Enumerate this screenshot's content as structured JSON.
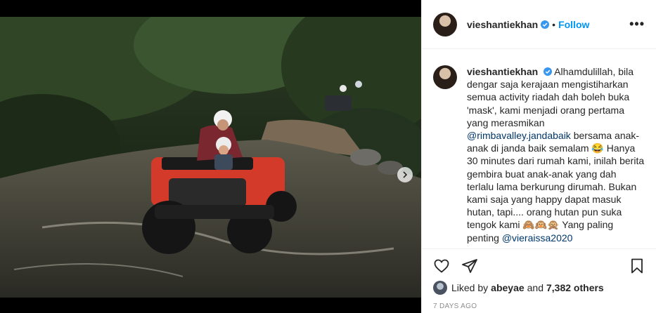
{
  "post": {
    "username": "vieshantiekhan",
    "follow_label": "Follow",
    "bullet": "•",
    "more_label": "•••"
  },
  "caption": {
    "username": "vieshantiekhan",
    "text_1": "Alhamdulillah, bila dengar saja kerajaan mengistiharkan semua activity riadah dah boleh buka 'mask', kami menjadi orang pertama yang merasmikan",
    "mention_1": "@rimbavalley.jandabaik",
    "text_2": "bersama anak-anak di janda baik semalam 😂 Hanya 30 minutes dari rumah kami, inilah berita gembira buat anak-anak yang dah terlalu lama berkurung dirumah. Bukan kami saja yang happy dapat masuk hutan, tapi.... orang hutan pun suka tengok kami 🙈🙉🙊 Yang paling penting",
    "mention_2": "@vieraissa2020"
  },
  "likes": {
    "prefix": "Liked by",
    "user": "abeyae",
    "mid": "and",
    "count": "7,382 others"
  },
  "timestamp": "7 DAYS AGO",
  "icons": [
    "verified-badge-icon",
    "heart-icon",
    "share-icon",
    "bookmark-icon",
    "chevron-right-icon"
  ],
  "colors": {
    "accent": "#0095f6",
    "verified": "#3897f0",
    "mention": "#00376b"
  }
}
